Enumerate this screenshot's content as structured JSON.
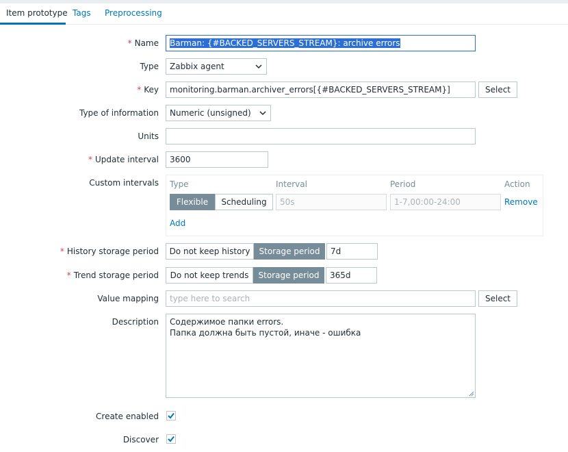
{
  "tabs": [
    {
      "label": "Item prototype",
      "active": true
    },
    {
      "label": "Tags",
      "active": false
    },
    {
      "label": "Preprocessing",
      "active": false
    }
  ],
  "form": {
    "name": {
      "label": "Name",
      "required": true,
      "value": "Barman: {#BACKED_SERVERS_STREAM}: archive errors"
    },
    "type": {
      "label": "Type",
      "value": "Zabbix agent"
    },
    "key": {
      "label": "Key",
      "required": true,
      "value": "monitoring.barman.archiver_errors[{#BACKED_SERVERS_STREAM}]",
      "select_label": "Select"
    },
    "type_of_information": {
      "label": "Type of information",
      "value": "Numeric (unsigned)"
    },
    "units": {
      "label": "Units",
      "value": ""
    },
    "update_interval": {
      "label": "Update interval",
      "required": true,
      "value": "3600"
    },
    "custom_intervals": {
      "label": "Custom intervals",
      "headers": {
        "type": "Type",
        "interval": "Interval",
        "period": "Period",
        "action": "Action"
      },
      "row": {
        "flexible": "Flexible",
        "scheduling": "Scheduling",
        "interval_value": "50s",
        "period_value": "1-7,00:00-24:00",
        "remove": "Remove"
      },
      "add": "Add"
    },
    "history": {
      "label": "History storage period",
      "required": true,
      "option_off": "Do not keep history",
      "option_on": "Storage period",
      "value": "7d"
    },
    "trend": {
      "label": "Trend storage period",
      "required": true,
      "option_off": "Do not keep trends",
      "option_on": "Storage period",
      "value": "365d"
    },
    "value_mapping": {
      "label": "Value mapping",
      "placeholder": "type here to search",
      "select_label": "Select"
    },
    "description": {
      "label": "Description",
      "lines": [
        "Содержимое папки errors.",
        "Папка должна быть пустой, иначе - ошибка"
      ]
    },
    "create_enabled": {
      "label": "Create enabled",
      "checked": true
    },
    "discover": {
      "label": "Discover",
      "checked": true
    }
  },
  "colors": {
    "accent": "#0275b8",
    "required": "#d4424a",
    "segment_active": "#768d99"
  }
}
